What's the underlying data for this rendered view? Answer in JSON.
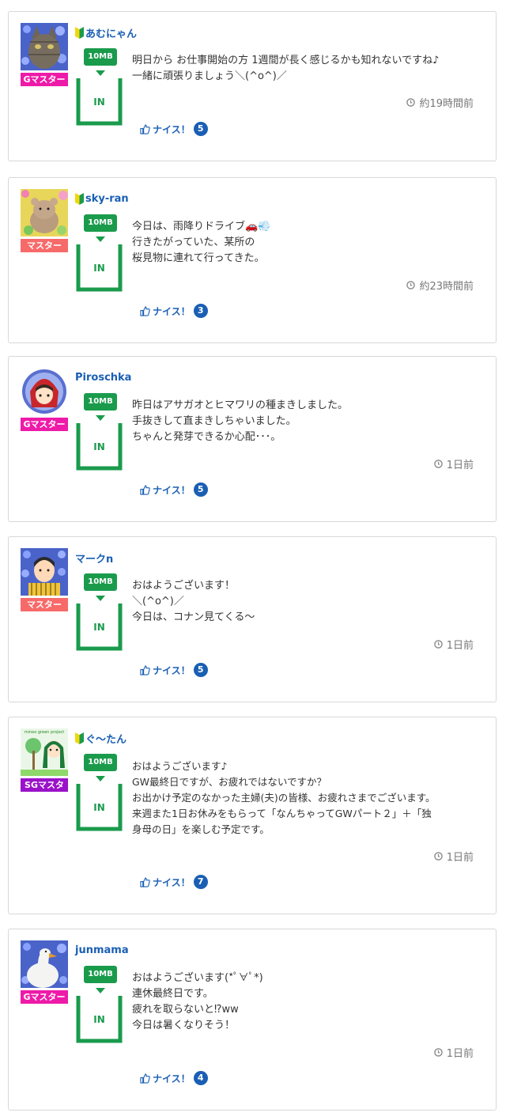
{
  "posts": [
    {
      "username": "あむにゃん",
      "beginner": true,
      "rank": "Gマスター",
      "rank_color": "#ee1aa8",
      "data_badge": "10MB",
      "status": "IN",
      "message": "明日から お仕事開始の方 1週間が長く感じるかも知れないですね♪\n一緒に頑張りましょう＼(^o^)／",
      "time": "約19時間前",
      "nice_label": "ナイス！",
      "nice_count": "5",
      "avatar": "cat"
    },
    {
      "username": "sky-ran",
      "beginner": true,
      "rank": "マスター",
      "rank_color": "#f76a6a",
      "data_badge": "10MB",
      "status": "IN",
      "message": "今日は、雨降りドライブ🚗💨\n行きたがっていた、某所の\n桜見物に連れて行ってきた。",
      "time": "約23時間前",
      "nice_label": "ナイス！",
      "nice_count": "3",
      "avatar": "hamster"
    },
    {
      "username": "Piroschka",
      "beginner": false,
      "rank": "Gマスター",
      "rank_color": "#ee1aa8",
      "data_badge": "10MB",
      "status": "IN",
      "message": "昨日はアサガオとヒマワリの種まきしました。\n手抜きして直まきしちゃいました。\nちゃんと発芽できるか心配･･･。",
      "time": "1日前",
      "nice_label": "ナイス！",
      "nice_count": "5",
      "avatar": "girl"
    },
    {
      "username": "マークn",
      "beginner": false,
      "rank": "マスター",
      "rank_color": "#f76a6a",
      "data_badge": "10MB",
      "status": "IN",
      "message": "おはようございます！\n＼(^o^)／\n今日は、コナン見てくる〜",
      "time": "1日前",
      "nice_label": "ナイス！",
      "nice_count": "5",
      "avatar": "man"
    },
    {
      "username": "ぐ〜たん",
      "beginner": true,
      "rank": "SGマスタ",
      "rank_color": "#9a12c9",
      "data_badge": "10MB",
      "status": "IN",
      "message": "おはようございます♪\nGW最終日ですが、お疲れではないですか？\nお出かけ予定のなかった主婦(夫)の皆様、お疲れさまでございます。\n来週また1日お休みをもらって「なんちゃってGWパート２」＋「独\n身母の日」を楽しむ予定です。",
      "time": "1日前",
      "nice_label": "ナイス！",
      "nice_count": "7",
      "avatar": "mineo",
      "avatar_text": "mineo green project"
    },
    {
      "username": "junmama",
      "beginner": false,
      "rank": "Gマスター",
      "rank_color": "#ee1aa8",
      "data_badge": "10MB",
      "status": "IN",
      "message": "おはようございます(*ﾟ∀ﾟ*)\n連休最終日です。\n疲れを取らないと⁉ww\n今日は暑くなりそう！",
      "time": "1日前",
      "nice_label": "ナイス！",
      "nice_count": "4",
      "avatar": "duck"
    }
  ],
  "icons": {
    "beginner": "beginner-mark-icon",
    "clock": "clock-icon",
    "thumb": "thumbs-up-icon",
    "arrow": "down-arrow-icon"
  }
}
